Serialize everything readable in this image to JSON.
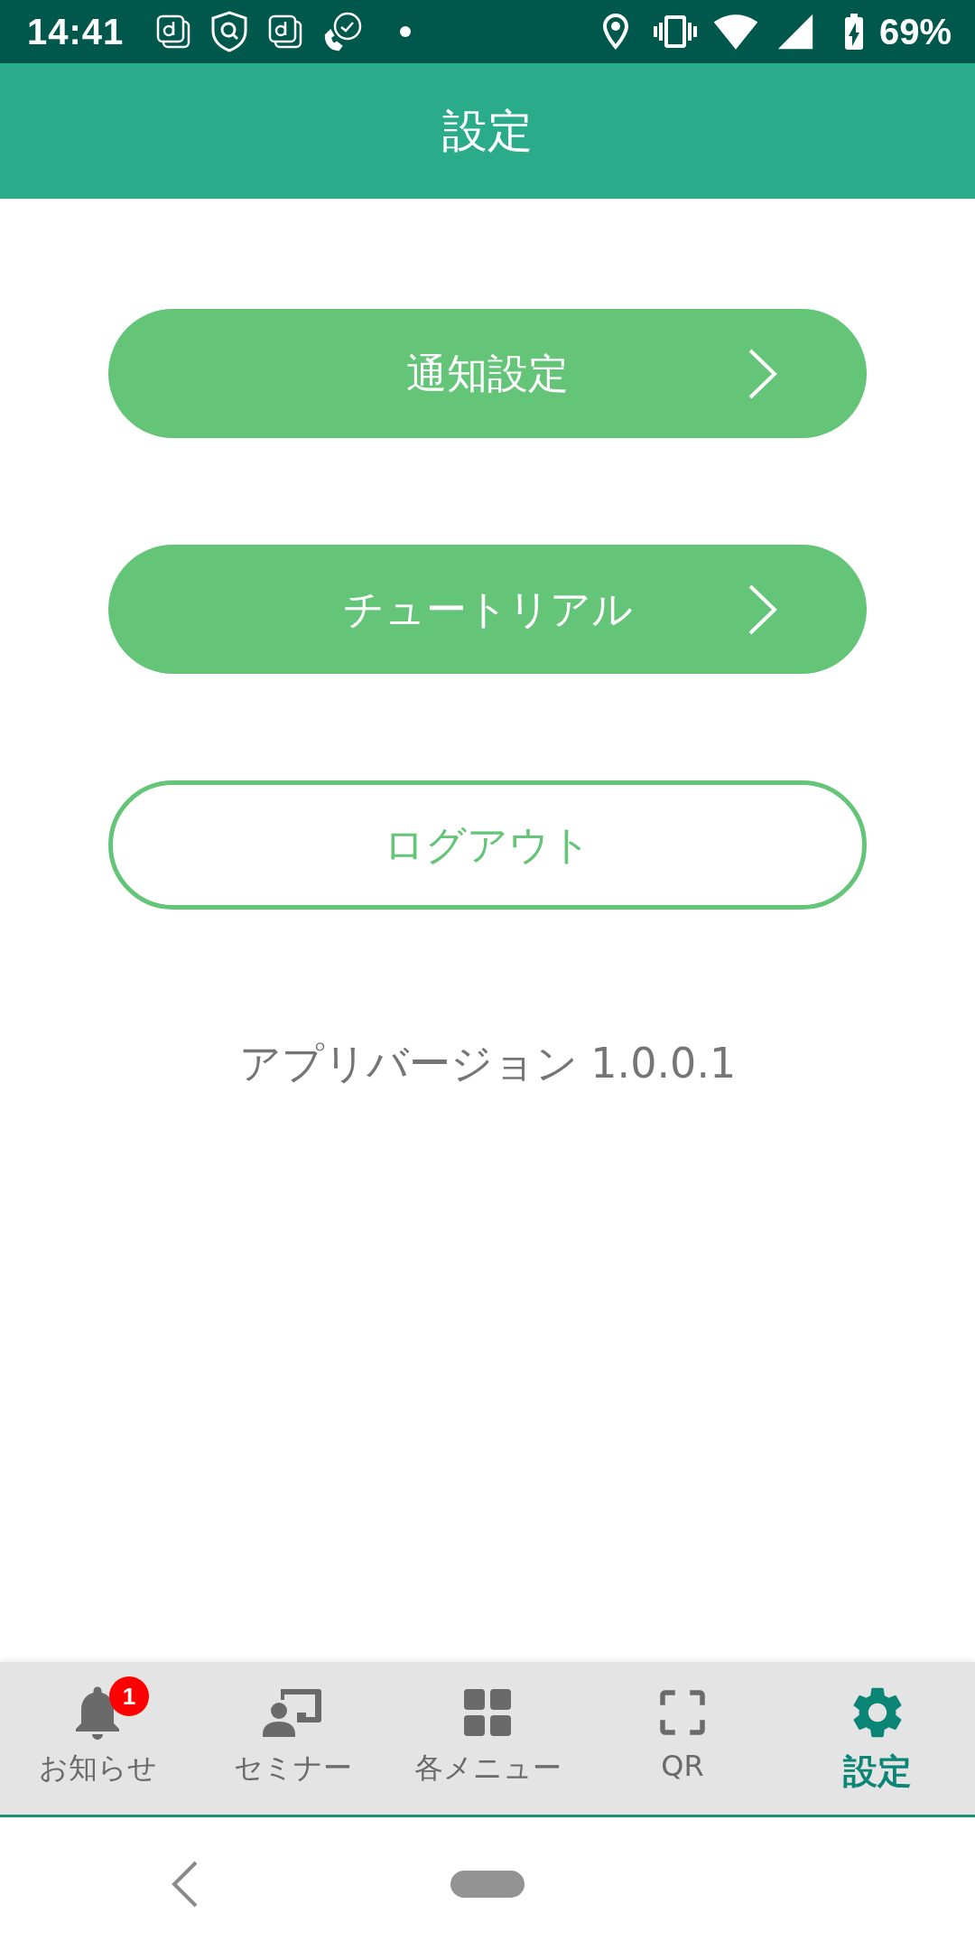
{
  "status_bar": {
    "time": "14:41",
    "battery": "69%"
  },
  "header": {
    "title": "設定"
  },
  "menu": [
    {
      "label": "通知設定",
      "kind": "filled"
    },
    {
      "label": "チュートリアル",
      "kind": "filled"
    },
    {
      "label": "ログアウト",
      "kind": "outlined"
    }
  ],
  "version": "アプリバージョン 1.0.0.1",
  "tabs": [
    {
      "label": "お知らせ",
      "badge": "1",
      "selected": false
    },
    {
      "label": "セミナー",
      "selected": false
    },
    {
      "label": "各メニュー",
      "selected": false
    },
    {
      "label": "QR",
      "selected": false
    },
    {
      "label": "設定",
      "selected": true
    }
  ]
}
